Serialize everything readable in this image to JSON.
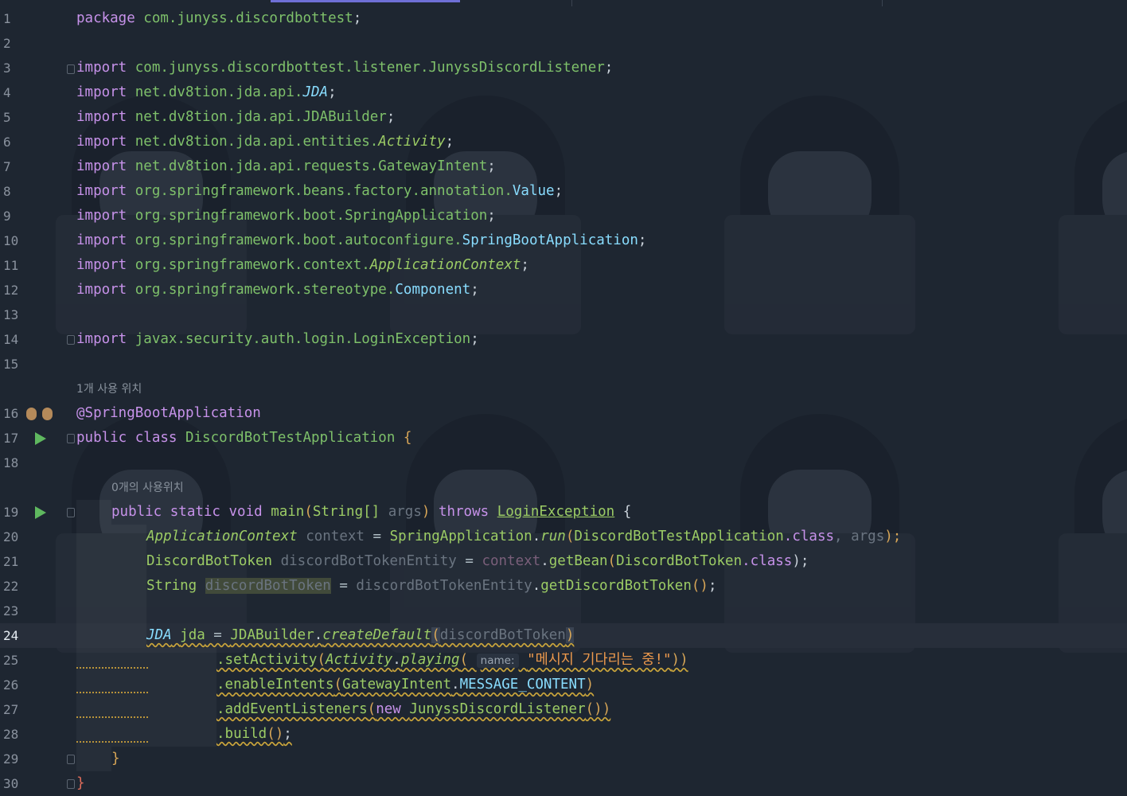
{
  "editor": {
    "usage_hints": {
      "class_usage": "1개 사용 위치",
      "main_usage": "0개의 사용위치"
    },
    "inlay_hint": "name:",
    "active_line": 24,
    "line_numbers": [
      "1",
      "2",
      "3",
      "4",
      "5",
      "6",
      "7",
      "8",
      "9",
      "10",
      "11",
      "12",
      "13",
      "14",
      "15",
      "16",
      "17",
      "18",
      "19",
      "20",
      "21",
      "22",
      "23",
      "24",
      "25",
      "26",
      "27",
      "28",
      "29",
      "30"
    ]
  },
  "code": {
    "l1": [
      "package",
      " com.junyss.discordbottest",
      ";"
    ],
    "l3": [
      "import",
      " com.junyss.discordbottest.listener.JunyssDiscordListener",
      ";"
    ],
    "l4": [
      "import",
      " net.dv8tion.jda.api.",
      "JDA",
      ";"
    ],
    "l5": [
      "import",
      " net.dv8tion.jda.api.JDABuilder",
      ";"
    ],
    "l6": [
      "import",
      " net.dv8tion.jda.api.entities.",
      "Activity",
      ";"
    ],
    "l7": [
      "import",
      " net.dv8tion.jda.api.requests.GatewayIntent",
      ";"
    ],
    "l8": [
      "import",
      " org.springframework.beans.factory.annotation.",
      "Value",
      ";"
    ],
    "l9": [
      "import",
      " org.springframework.boot.SpringApplication",
      ";"
    ],
    "l10": [
      "import",
      " org.springframework.boot.autoconfigure.",
      "SpringBootApplication",
      ";"
    ],
    "l11": [
      "import",
      " org.springframework.context.",
      "ApplicationContext",
      ";"
    ],
    "l12": [
      "import",
      " org.springframework.stereotype.",
      "Component",
      ";"
    ],
    "l14": [
      "import",
      " javax.security.auth.login.LoginException",
      ";"
    ],
    "l16": [
      "@SpringBootApplication"
    ],
    "l17": [
      "public class ",
      "DiscordBotTestApplication",
      " {"
    ],
    "l19": [
      "public static void ",
      "main",
      "(",
      "String[]",
      " args",
      ") ",
      "throws ",
      "LoginException",
      " {"
    ],
    "l20": [
      "ApplicationContext",
      " context",
      " = ",
      "SpringApplication",
      ".",
      "run",
      "(",
      "DiscordBotTestApplication",
      ".class",
      ", ",
      "args",
      ");"
    ],
    "l21": [
      "DiscordBotToken",
      " discordBotTokenEntity",
      " = ",
      "context",
      ".",
      "getBean",
      "(",
      "DiscordBotToken",
      ".class",
      ");"
    ],
    "l22": [
      "String ",
      "discordBotToken",
      " = ",
      "discordBotTokenEntity",
      ".",
      "getDiscordBotToken",
      "()",
      ";"
    ],
    "l24": [
      "JDA",
      " ",
      "jda",
      " = ",
      "JDABuilder",
      ".",
      "createDefault",
      "(",
      "discordBotToken",
      ")"
    ],
    "l25": [
      ".setActivity",
      "(",
      "Activity",
      ".",
      "playing",
      "( ",
      "\"메시지 기다리는 중!\"",
      "))"
    ],
    "l26": [
      ".enableIntents",
      "(",
      "GatewayIntent",
      ".",
      "MESSAGE_CONTENT",
      ")"
    ],
    "l27": [
      ".addEventListeners",
      "(",
      "new ",
      "JunyssDiscordListener",
      "())"
    ],
    "l28": [
      ".build",
      "()",
      ";"
    ],
    "l29": [
      "}"
    ],
    "l30": [
      "}"
    ]
  },
  "colors": {
    "background": "#1e2631",
    "keyword": "#c792ea",
    "package": "#7ec06a",
    "class": "#89ddff",
    "string": "#ee9a4d",
    "run_icon": "#5fb85f",
    "tab_indicator": "#6e6fd6"
  },
  "icons": [
    "run-icon",
    "spring-bean-icon",
    "fold-icon"
  ]
}
